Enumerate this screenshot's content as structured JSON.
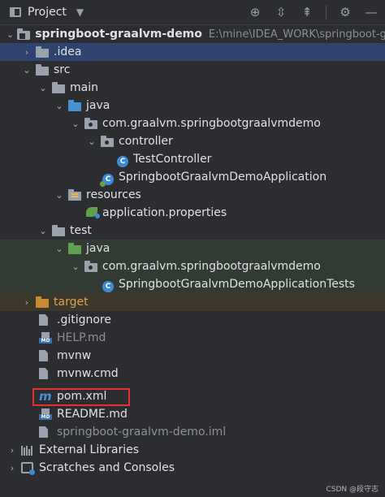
{
  "toolbar": {
    "title": "Project",
    "icons": [
      "project-view-icon",
      "chevron-down-icon",
      "locate-icon",
      "expand-all-icon",
      "collapse-all-icon",
      "gear-icon",
      "minimize-icon"
    ],
    "minimize_glyph": "—"
  },
  "tree": {
    "root": {
      "name": "springboot-graalvm-demo",
      "path": "E:\\mine\\IDEA_WORK\\springboot-gra"
    },
    "idea": ".idea",
    "src": "src",
    "main": "main",
    "java_main": "java",
    "pkg_main": "com.graalvm.springbootgraalvmdemo",
    "controller": "controller",
    "test_controller": "TestController",
    "application": "SpringbootGraalvmDemoApplication",
    "resources": "resources",
    "app_props": "application.properties",
    "test": "test",
    "java_test": "java",
    "pkg_test": "com.graalvm.springbootgraalvmdemo",
    "app_tests": "SpringbootGraalvmDemoApplicationTests",
    "target": "target",
    "gitignore": ".gitignore",
    "help_md": "HELP.md",
    "mvnw": "mvnw",
    "mvnw_cmd": "mvnw.cmd",
    "pom": "pom.xml",
    "readme": "README.md",
    "iml": "springboot-graalvm-demo.iml",
    "external_libs": "External Libraries",
    "scratches": "Scratches and Consoles"
  },
  "icon_text": {
    "class_letter": "C",
    "md_badge": "MD",
    "maven_letter": "m"
  },
  "colors": {
    "selection": "#2e436e",
    "test_row": "#323b33",
    "target_row": "#3c3729",
    "highlight": "#e03030"
  },
  "watermark": "CSDN @段守志"
}
